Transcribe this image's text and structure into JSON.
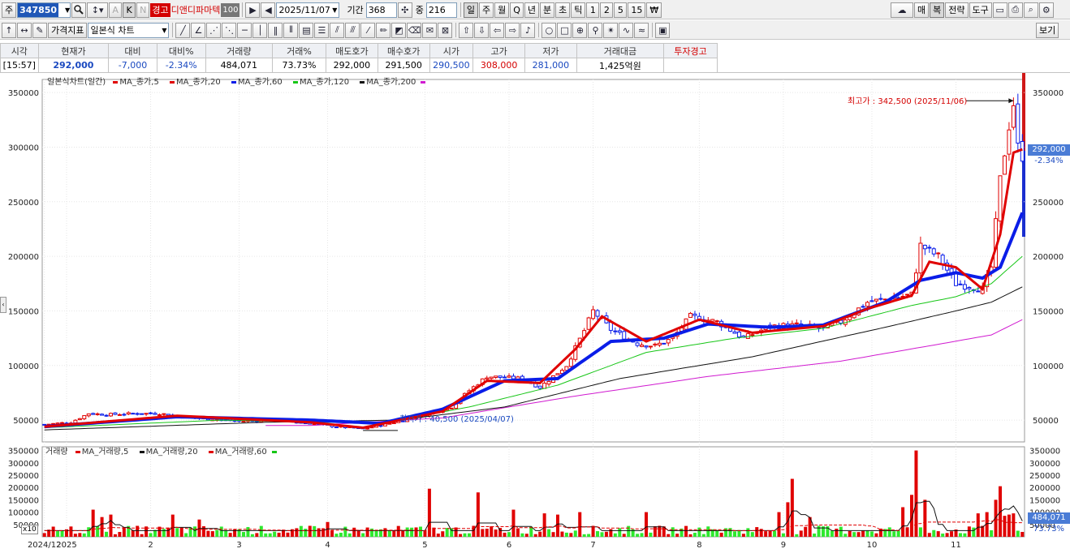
{
  "toolbar1": {
    "market_label": "주",
    "stock_code": "347850",
    "badge_warning": "경고",
    "stock_name": "디앤디파마텍",
    "badge_num": "100",
    "date": "2025/11/07",
    "period_label": "기간",
    "period_value": "368",
    "zoom_label": "중",
    "zoom_value": "216",
    "period_buttons": [
      "일",
      "주",
      "월",
      "Q",
      "년",
      "분",
      "초",
      "틱",
      "1",
      "2",
      "5",
      "15"
    ],
    "selected_period": "일",
    "currency_label": "₩",
    "kb_k": "K",
    "kb_a": "A",
    "kb_n": "N",
    "right_buttons": [
      "매",
      "복",
      "전략",
      "도구"
    ]
  },
  "toolbar2": {
    "indicator_button": "가격지표",
    "chart_type": "일본식 차트",
    "view_button": "보기"
  },
  "quote": {
    "headers": [
      "시각",
      "현재가",
      "대비",
      "대비%",
      "거래량",
      "거래%",
      "매도호가",
      "매수호가",
      "시가",
      "고가",
      "저가",
      "거래대금",
      "투자경고"
    ],
    "values": [
      "[15:57]",
      "292,000",
      "-7,000",
      "-2.34%",
      "484,071",
      "73.73%",
      "292,000",
      "291,500",
      "290,500",
      "308,000",
      "281,000",
      "1,425억원",
      ""
    ]
  },
  "chart_legend": {
    "title": "일본식차트(일간)",
    "ma": [
      "MA_종가,5",
      "MA_종가,20",
      "MA_종가,60",
      "MA_종가,120",
      "MA_종가,200"
    ],
    "ma_colors": [
      "#e00000",
      "#e00000",
      "#0a1de8",
      "#17c617",
      "#111111",
      "#d01ad0"
    ]
  },
  "volume_legend": {
    "title": "거래량",
    "ma": [
      "MA_거래량,5",
      "MA_거래량,20",
      "MA_거래량,60"
    ],
    "ma_colors": [
      "#e00000",
      "#111111",
      "#e00000",
      "#17c617"
    ]
  },
  "annotations": {
    "high": "최고가 : 342,500 (2025/11/06)",
    "low": "최저가 : 40,500 (2025/04/07)",
    "price_tag": "292,000",
    "price_change": "-2.34%",
    "volume_tag": "484,071",
    "volume_pct": "73.73%",
    "vol_scale": "x10"
  },
  "chart_data": [
    {
      "type": "candlestick",
      "title": "일본식차트(일간)",
      "y_ticks": [
        50000,
        100000,
        150000,
        200000,
        250000,
        300000,
        350000
      ],
      "y_tick_labels": [
        "50000",
        "100000",
        "150000",
        "200000",
        "250000",
        "300000",
        "350000"
      ],
      "ylim": [
        30000,
        362000
      ],
      "x_labels": [
        "2024/12",
        "2025",
        "2",
        "3",
        "4",
        "5",
        "6",
        "7",
        "8",
        "9",
        "10",
        "11"
      ],
      "x_label_index": [
        0,
        5,
        24,
        44,
        64,
        86,
        105,
        124,
        148,
        167,
        187,
        206
      ],
      "n_days": 216,
      "close_anchors": [
        [
          0,
          46000
        ],
        [
          6,
          48000
        ],
        [
          10,
          56000
        ],
        [
          14,
          55000
        ],
        [
          20,
          56000
        ],
        [
          26,
          56000
        ],
        [
          34,
          52000
        ],
        [
          44,
          49000
        ],
        [
          52,
          50000
        ],
        [
          60,
          47000
        ],
        [
          66,
          44000
        ],
        [
          72,
          42000
        ],
        [
          78,
          47000
        ],
        [
          86,
          55000
        ],
        [
          92,
          62000
        ],
        [
          96,
          77000
        ],
        [
          100,
          90000
        ],
        [
          108,
          88000
        ],
        [
          112,
          80000
        ],
        [
          118,
          100000
        ],
        [
          122,
          132000
        ],
        [
          124,
          150000
        ],
        [
          128,
          133000
        ],
        [
          134,
          120000
        ],
        [
          138,
          118000
        ],
        [
          142,
          125000
        ],
        [
          146,
          145000
        ],
        [
          152,
          140000
        ],
        [
          158,
          125000
        ],
        [
          164,
          136000
        ],
        [
          170,
          137000
        ],
        [
          176,
          134000
        ],
        [
          180,
          140000
        ],
        [
          186,
          158000
        ],
        [
          192,
          162000
        ],
        [
          196,
          165000
        ],
        [
          198,
          210000
        ],
        [
          202,
          200000
        ],
        [
          206,
          175000
        ],
        [
          212,
          170000
        ],
        [
          214,
          190000
        ],
        [
          216,
          270000
        ],
        [
          218,
          320000
        ],
        [
          219,
          340000
        ],
        [
          220,
          300000
        ],
        [
          221,
          292000
        ]
      ],
      "ma5_anchors": [
        [
          0,
          44000
        ],
        [
          30,
          54000
        ],
        [
          60,
          48000
        ],
        [
          72,
          43000
        ],
        [
          90,
          58000
        ],
        [
          100,
          86000
        ],
        [
          112,
          84000
        ],
        [
          120,
          115000
        ],
        [
          126,
          145000
        ],
        [
          136,
          122000
        ],
        [
          148,
          142000
        ],
        [
          160,
          130000
        ],
        [
          176,
          136000
        ],
        [
          186,
          152000
        ],
        [
          196,
          164000
        ],
        [
          200,
          195000
        ],
        [
          206,
          190000
        ],
        [
          212,
          170000
        ],
        [
          216,
          220000
        ],
        [
          219,
          295000
        ],
        [
          221,
          298000
        ]
      ],
      "ma20_anchors": [
        [
          0,
          44000
        ],
        [
          30,
          53000
        ],
        [
          60,
          50000
        ],
        [
          76,
          47000
        ],
        [
          90,
          60000
        ],
        [
          104,
          86000
        ],
        [
          116,
          88000
        ],
        [
          128,
          122000
        ],
        [
          140,
          125000
        ],
        [
          150,
          138000
        ],
        [
          164,
          135000
        ],
        [
          176,
          137000
        ],
        [
          190,
          158000
        ],
        [
          198,
          178000
        ],
        [
          206,
          185000
        ],
        [
          212,
          180000
        ],
        [
          216,
          190000
        ],
        [
          219,
          220000
        ],
        [
          221,
          240000
        ]
      ],
      "ma60_anchors": [
        [
          0,
          43000
        ],
        [
          40,
          50000
        ],
        [
          76,
          47000
        ],
        [
          96,
          62000
        ],
        [
          116,
          82000
        ],
        [
          136,
          112000
        ],
        [
          156,
          125000
        ],
        [
          176,
          134000
        ],
        [
          196,
          155000
        ],
        [
          206,
          163000
        ],
        [
          214,
          175000
        ],
        [
          221,
          200000
        ]
      ],
      "ma120_anchors": [
        [
          0,
          41000
        ],
        [
          50,
          48000
        ],
        [
          80,
          50000
        ],
        [
          104,
          62000
        ],
        [
          130,
          88000
        ],
        [
          160,
          108000
        ],
        [
          190,
          135000
        ],
        [
          206,
          150000
        ],
        [
          214,
          158000
        ],
        [
          221,
          172000
        ]
      ],
      "ma200_anchors": [
        [
          60,
          45000
        ],
        [
          90,
          52000
        ],
        [
          120,
          72000
        ],
        [
          150,
          90000
        ],
        [
          180,
          104000
        ],
        [
          200,
          118000
        ],
        [
          214,
          128000
        ],
        [
          221,
          142000
        ]
      ],
      "high_value": 342500,
      "low_value": 40500,
      "current": 292000
    },
    {
      "type": "bar",
      "title": "거래량",
      "y_ticks": [
        50000,
        100000,
        150000,
        200000,
        250000,
        300000,
        350000
      ],
      "y_tick_labels": [
        "50000",
        "100000",
        "150000",
        "200000",
        "250000",
        "300000",
        "350000"
      ],
      "ylim": [
        0,
        365000
      ],
      "spikes": [
        [
          11,
          110000
        ],
        [
          13,
          80000
        ],
        [
          15,
          90000
        ],
        [
          29,
          90000
        ],
        [
          35,
          70000
        ],
        [
          64,
          60000
        ],
        [
          87,
          195000
        ],
        [
          98,
          180000
        ],
        [
          106,
          110000
        ],
        [
          113,
          95000
        ],
        [
          116,
          90000
        ],
        [
          121,
          100000
        ],
        [
          136,
          100000
        ],
        [
          166,
          100000
        ],
        [
          168,
          140000
        ],
        [
          169,
          235000
        ],
        [
          173,
          80000
        ],
        [
          194,
          120000
        ],
        [
          196,
          170000
        ],
        [
          197,
          350000
        ],
        [
          199,
          150000
        ],
        [
          211,
          95000
        ],
        [
          213,
          100000
        ],
        [
          215,
          150000
        ],
        [
          216,
          205000
        ],
        [
          217,
          85000
        ],
        [
          218,
          90000
        ],
        [
          219,
          95000
        ]
      ],
      "base_volume": 25000,
      "current": 484071
    }
  ]
}
